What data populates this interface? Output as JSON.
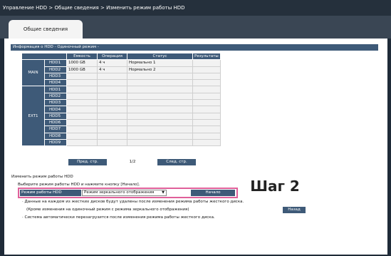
{
  "breadcrumb": "Управление HDD > Общие сведения > Изменить режим работы HDD",
  "tab_label": "Общие сведения",
  "info_header": "Информация о HDD - Одиночный режим -",
  "columns": [
    "Емкость",
    "Операция",
    "Статус",
    "Результаты"
  ],
  "groups": [
    {
      "name": "MAIN",
      "rows": [
        {
          "hdd": "HDD1",
          "capacity": "1000 GB",
          "operation": "4 ч",
          "status": "Нормально 1",
          "result": ""
        },
        {
          "hdd": "HDD2",
          "capacity": "1000 GB",
          "operation": "4 ч",
          "status": "Нормально 2",
          "result": ""
        },
        {
          "hdd": "HDD3",
          "capacity": "",
          "operation": "",
          "status": "",
          "result": ""
        },
        {
          "hdd": "HDD4",
          "capacity": "",
          "operation": "",
          "status": "",
          "result": ""
        }
      ]
    },
    {
      "name": "EXT1",
      "rows": [
        {
          "hdd": "HDD1",
          "capacity": "",
          "operation": "",
          "status": "",
          "result": ""
        },
        {
          "hdd": "HDD2",
          "capacity": "",
          "operation": "",
          "status": "",
          "result": ""
        },
        {
          "hdd": "HDD3",
          "capacity": "",
          "operation": "",
          "status": "",
          "result": ""
        },
        {
          "hdd": "HDD4",
          "capacity": "",
          "operation": "",
          "status": "",
          "result": ""
        },
        {
          "hdd": "HDD5",
          "capacity": "",
          "operation": "",
          "status": "",
          "result": ""
        },
        {
          "hdd": "HDD6",
          "capacity": "",
          "operation": "",
          "status": "",
          "result": ""
        },
        {
          "hdd": "HDD7",
          "capacity": "",
          "operation": "",
          "status": "",
          "result": ""
        },
        {
          "hdd": "HDD8",
          "capacity": "",
          "operation": "",
          "status": "",
          "result": ""
        },
        {
          "hdd": "HDD9",
          "capacity": "",
          "operation": "",
          "status": "",
          "result": ""
        }
      ]
    }
  ],
  "pagination": {
    "prev": "Пред. стр.",
    "page": "1/2",
    "next": "След. стр."
  },
  "mode_section": {
    "title": "Изменить режим работы HDD",
    "hint": "Выберите режим работы HDD и нажмите кнопку [Начало].",
    "label": "Режим работы HDD",
    "selected": "Режим зеркального отображения",
    "start": "Начало"
  },
  "step_label": "Шаг 2",
  "notes": {
    "line1": "· Данные на каждом из жестких дисков будут удалены после изменения режима работы жесткого диска.",
    "line2": "(Кроме изменения на одиночный режим с режима зеркального отображения)",
    "back": "Назад",
    "line3": "· Система автоматически перезагрузится после изменения режима работы жесткого диска."
  },
  "colors": {
    "accent": "#3e5a78",
    "highlight": "#e0609a",
    "background": "#1f2b38"
  },
  "icons": {
    "dropdown": "chevron-down-icon"
  }
}
